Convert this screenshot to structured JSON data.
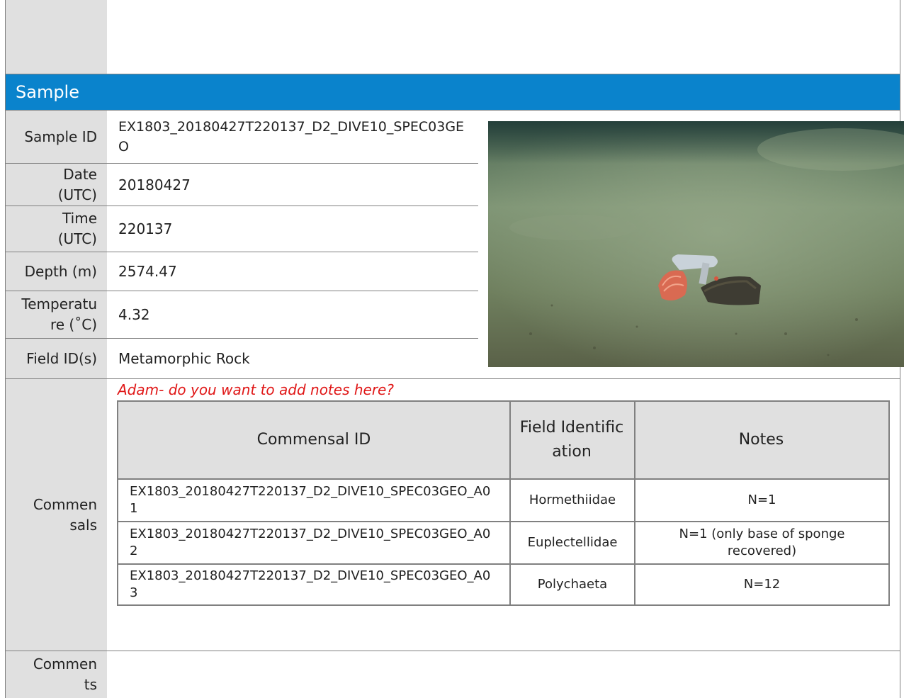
{
  "section": {
    "title": "Sample"
  },
  "fields": [
    {
      "label": "Sample ID",
      "value": "EX1803_20180427T220137_D2_DIVE10_SPEC03GEO"
    },
    {
      "label": "Date (UTC)",
      "value": "20180427"
    },
    {
      "label": "Time (UTC)",
      "value": "220137"
    },
    {
      "label": "Depth (m)",
      "value": "2574.47"
    },
    {
      "label": "Temperature (˚C)",
      "value": "4.32"
    },
    {
      "label": "Field ID(s)",
      "value": "Metamorphic Rock"
    }
  ],
  "commensals": {
    "label": "Commensals",
    "note": "Adam- do you want to add notes here?",
    "headers": [
      "Commensal ID",
      "Field Identification",
      "Notes"
    ],
    "rows": [
      {
        "id": "EX1803_20180427T220137_D2_DIVE10_SPEC03GEO_A01",
        "field_id": "Hormethiidae",
        "notes": "N=1"
      },
      {
        "id": "EX1803_20180427T220137_D2_DIVE10_SPEC03GEO_A02",
        "field_id": "Euplectellidae",
        "notes": "N=1 (only base of sponge recovered)"
      },
      {
        "id": "EX1803_20180427T220137_D2_DIVE10_SPEC03GEO_A03",
        "field_id": "Polychaeta",
        "notes": "N=12"
      }
    ]
  },
  "comments": {
    "label": "Comments",
    "value": ""
  },
  "photo": {
    "description_icon": "seafloor-photo"
  },
  "colors": {
    "header_band": "#0a83cc",
    "label_bg": "#e0e0e0",
    "note": "#e01616",
    "border": "#808080"
  }
}
